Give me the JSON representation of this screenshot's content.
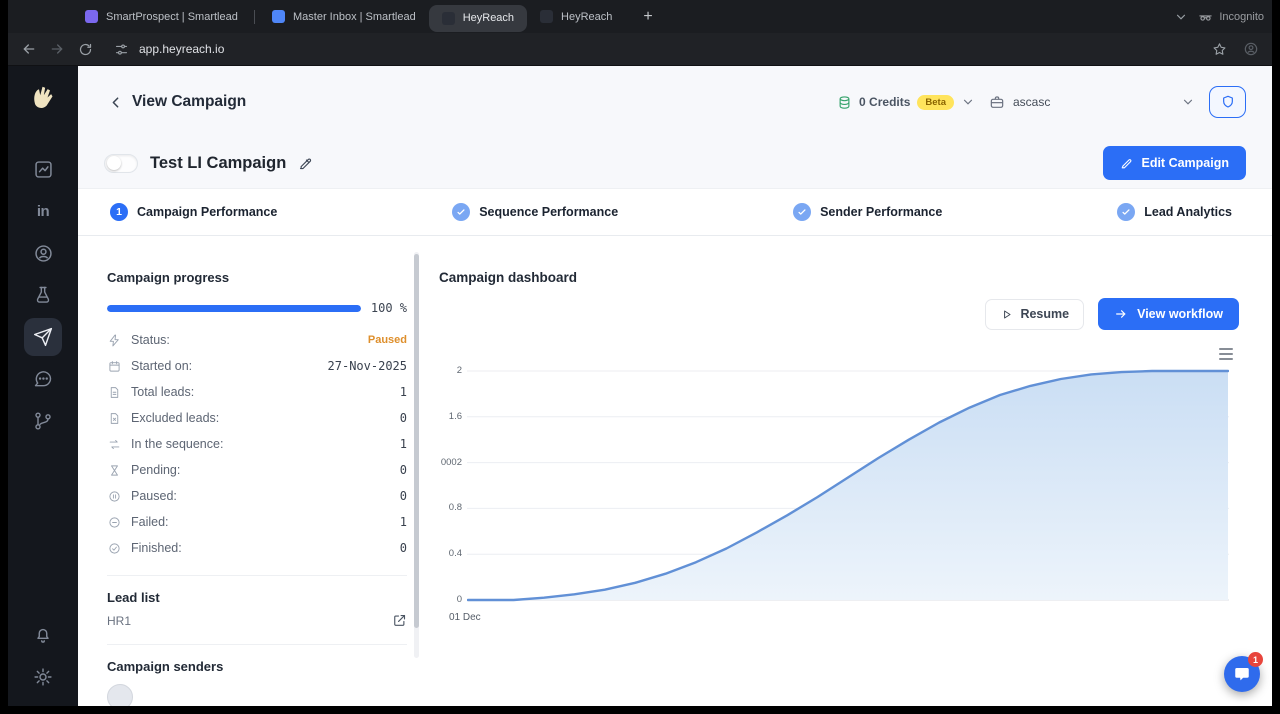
{
  "browser": {
    "tabs": [
      {
        "title": "SmartProspect | Smartlead"
      },
      {
        "title": "Master Inbox | Smartlead"
      },
      {
        "title": "HeyReach"
      },
      {
        "title": "HeyReach"
      }
    ],
    "new_tab_label": "+",
    "incognito_label": "Incognito",
    "url": "app.heyreach.io"
  },
  "header": {
    "title": "View Campaign",
    "credits_label": "0 Credits",
    "beta_label": "Beta",
    "workspace_label": "ascasc"
  },
  "campaign": {
    "name": "Test LI Campaign",
    "edit_button_label": "Edit Campaign"
  },
  "steps": [
    {
      "badge": "1",
      "label": "Campaign Performance"
    },
    {
      "label": "Sequence Performance"
    },
    {
      "label": "Sender Performance"
    },
    {
      "label": "Lead Analytics"
    }
  ],
  "left": {
    "progress_title": "Campaign progress",
    "progress_percent_label": "100 %",
    "progress_value": 100,
    "stats": [
      {
        "label": "Status:",
        "value": "Paused"
      },
      {
        "label": "Started on:",
        "value": "27-Nov-2025"
      },
      {
        "label": "Total leads:",
        "value": "1"
      },
      {
        "label": "Excluded leads:",
        "value": "0"
      },
      {
        "label": "In the sequence:",
        "value": "1"
      },
      {
        "label": "Pending:",
        "value": "0"
      },
      {
        "label": "Paused:",
        "value": "0"
      },
      {
        "label": "Failed:",
        "value": "1"
      },
      {
        "label": "Finished:",
        "value": "0"
      }
    ],
    "lead_list_title": "Lead list",
    "lead_list_name": "HR1",
    "senders_title": "Campaign senders"
  },
  "dashboard": {
    "title": "Campaign dashboard",
    "resume_label": "Resume",
    "view_workflow_label": "View workflow"
  },
  "chart_data": {
    "type": "area",
    "title": "Campaign dashboard",
    "x": [
      0,
      0.06,
      0.1,
      0.14,
      0.18,
      0.22,
      0.26,
      0.3,
      0.34,
      0.38,
      0.42,
      0.46,
      0.5,
      0.54,
      0.58,
      0.62,
      0.66,
      0.7,
      0.74,
      0.78,
      0.82,
      0.86,
      0.9,
      0.94,
      1.0
    ],
    "values": [
      0,
      0,
      0.02,
      0.05,
      0.09,
      0.15,
      0.23,
      0.33,
      0.45,
      0.59,
      0.74,
      0.9,
      1.07,
      1.24,
      1.4,
      1.55,
      1.68,
      1.79,
      1.87,
      1.93,
      1.97,
      1.99,
      2.0,
      2.0,
      2.0
    ],
    "ylim": [
      0,
      2
    ],
    "yticks": [
      {
        "v": 0,
        "label": "0"
      },
      {
        "v": 0.4,
        "label": "0.4"
      },
      {
        "v": 0.8,
        "label": "0.8"
      },
      {
        "v": 1.2,
        "label": "0002"
      },
      {
        "v": 1.6,
        "label": "1.6"
      },
      {
        "v": 2,
        "label": "2"
      }
    ],
    "xticks": [
      "01 Dec"
    ],
    "grid": true,
    "legend": false,
    "line_color": "#6190d6",
    "fill_top": "#cadef4",
    "fill_bottom": "#edf4fb"
  },
  "intercom": {
    "badge": "1"
  },
  "colors": {
    "accent_blue": "#2b6ef6",
    "paused_orange": "#de8f2c",
    "beta_yellow": "#ffe45c",
    "credits_green": "#35a26b"
  }
}
